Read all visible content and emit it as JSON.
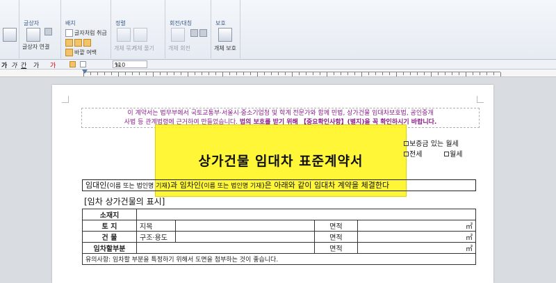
{
  "ribbon": {
    "groups": [
      {
        "title": "글상자",
        "items": [
          "글상자 연결"
        ]
      },
      {
        "title": "배치",
        "items": [
          "글자처럼 취급",
          "바깥 여백"
        ]
      },
      {
        "title": "정렬",
        "items": [
          "개체 묶기",
          "개체 풀기"
        ]
      },
      {
        "title": "회전/대칭",
        "items": [
          "개체 회전"
        ]
      },
      {
        "title": "보호",
        "items": [
          "개체 보호"
        ]
      }
    ]
  },
  "format_bar": {
    "glyphs": [
      "가",
      "가",
      "간",
      "가",
      "가"
    ],
    "zoom": "110",
    "zoom_unit": "%"
  },
  "document": {
    "notice_line1": "이 계약서는 법무부에서 국토교통부·서울시·중소기업청 및 학계 전문가와 함께 민법, 상가건물 임대차보호법, 공인중개",
    "notice_line2a": "사법 등 관계법령에 근거하여 만들었습니다.",
    "notice_line2b": "법의 보호를 받기 위해 【중요확인사항】(별지)을 꼭 확인하시기 바랍니다.",
    "title": "상가건물 임대차 표준계약서",
    "checkboxes": [
      "보증금 있는 월세",
      "전세",
      "월세"
    ],
    "parties": {
      "a": "임대인(",
      "a_small": "이름 또는 법인명 기재",
      "b": ")과 임차인(",
      "b_small": "이름 또는 법인명 기재",
      "c": ")은 아래와 같이 임대차 계약을 체결한다"
    },
    "section_title": "[임차 상가건물의 표시]",
    "table": {
      "address": "소재지",
      "land": "토   지",
      "jimok": "지목",
      "area": "면적",
      "building": "건   물",
      "structure": "구조·용도",
      "rented_part": "임차할부분",
      "unit": "㎡",
      "caution": "유의사항: 임차할 부분을 특정하기 위해서 도면을 첨부하는 것이 좋습니다."
    }
  },
  "colors": {
    "notice": "#8b1c8b",
    "highlight": "#fff514",
    "ribbon": "#e6ebf2"
  }
}
